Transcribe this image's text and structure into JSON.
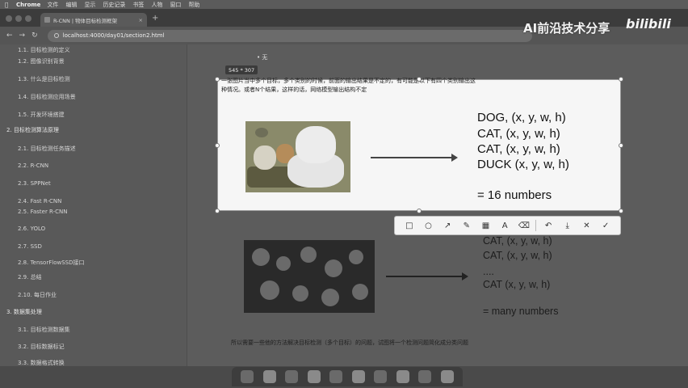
{
  "menubar": {
    "app": "Chrome",
    "items": [
      "文件",
      "编辑",
      "显示",
      "历史记录",
      "书签",
      "人物",
      "窗口",
      "帮助"
    ]
  },
  "browser": {
    "tab_title": "R-CNN | 物体目标检测框架",
    "tab_close": "×",
    "new_tab": "+",
    "url": "localhost:4000/day01/section2.html"
  },
  "sidebar": {
    "items": [
      {
        "level": 2,
        "text": "1.1. 目标检测的定义"
      },
      {
        "level": 2,
        "text": "1.2. 图像识别背景"
      },
      {
        "level": 2,
        "text": "1.3. 什么是目标检测"
      },
      {
        "level": 2,
        "text": "1.4. 目标检测应用场景"
      },
      {
        "level": 2,
        "text": "1.5. 开发环境搭建"
      },
      {
        "level": 1,
        "text": "2. 目标检测算法原理"
      },
      {
        "level": 2,
        "text": "2.1. 目标检测任务描述"
      },
      {
        "level": 2,
        "text": "2.2. R-CNN"
      },
      {
        "level": 2,
        "text": "2.3. SPPNet"
      },
      {
        "level": 2,
        "text": "2.4. Fast R-CNN"
      },
      {
        "level": 2,
        "text": "2.5. Faster R-CNN"
      },
      {
        "level": 2,
        "text": "2.6. YOLO"
      },
      {
        "level": 2,
        "text": "2.7. SSD"
      },
      {
        "level": 2,
        "text": "2.8. TensorFlowSSD接口"
      },
      {
        "level": 2,
        "text": "2.9. 总结"
      },
      {
        "level": 2,
        "text": "2.10. 每日作业"
      },
      {
        "level": 1,
        "text": "3. 数据集处理"
      },
      {
        "level": 2,
        "text": "3.1. 目标检测数据集"
      },
      {
        "level": 2,
        "text": "3.2. 目标数据标记"
      },
      {
        "level": 2,
        "text": "3.3. 数据格式转换"
      }
    ]
  },
  "content": {
    "bullet": "无",
    "para_line1": "一张图片当中多个目标，多个类别的时候，前面的输出结果是不定的，有可能是以下有四个类别输出这",
    "para_line2": "种情况。或者N个结果，这样的话，网络模型输出结构不定",
    "bottom_para": "所以需要一些他的方法解决目标检测（多个目标）的问题，试图将一个检测问题简化成分类问题",
    "list2": [
      "CAT, (x, y, w, h)",
      "CAT, (x, y, w, h)",
      "....",
      "CAT (x, y, w, h)",
      "= many numbers"
    ]
  },
  "overlay": {
    "dimensions": "545 * 307",
    "outputs": [
      "DOG, (x, y, w, h)",
      "CAT, (x, y, w, h)",
      "CAT, (x, y, w, h)",
      "DUCK (x, y, w, h)",
      "= 16 numbers"
    ],
    "tools": [
      "rectangle-tool",
      "ellipse-tool",
      "arrow-tool",
      "pen-tool",
      "mosaic-tool",
      "text-tool",
      "eraser-tool",
      "undo-tool",
      "download-tool",
      "cancel-tool",
      "confirm-tool"
    ]
  },
  "watermark": {
    "text": "AI前沿技术分享",
    "logo": "bilibili"
  }
}
